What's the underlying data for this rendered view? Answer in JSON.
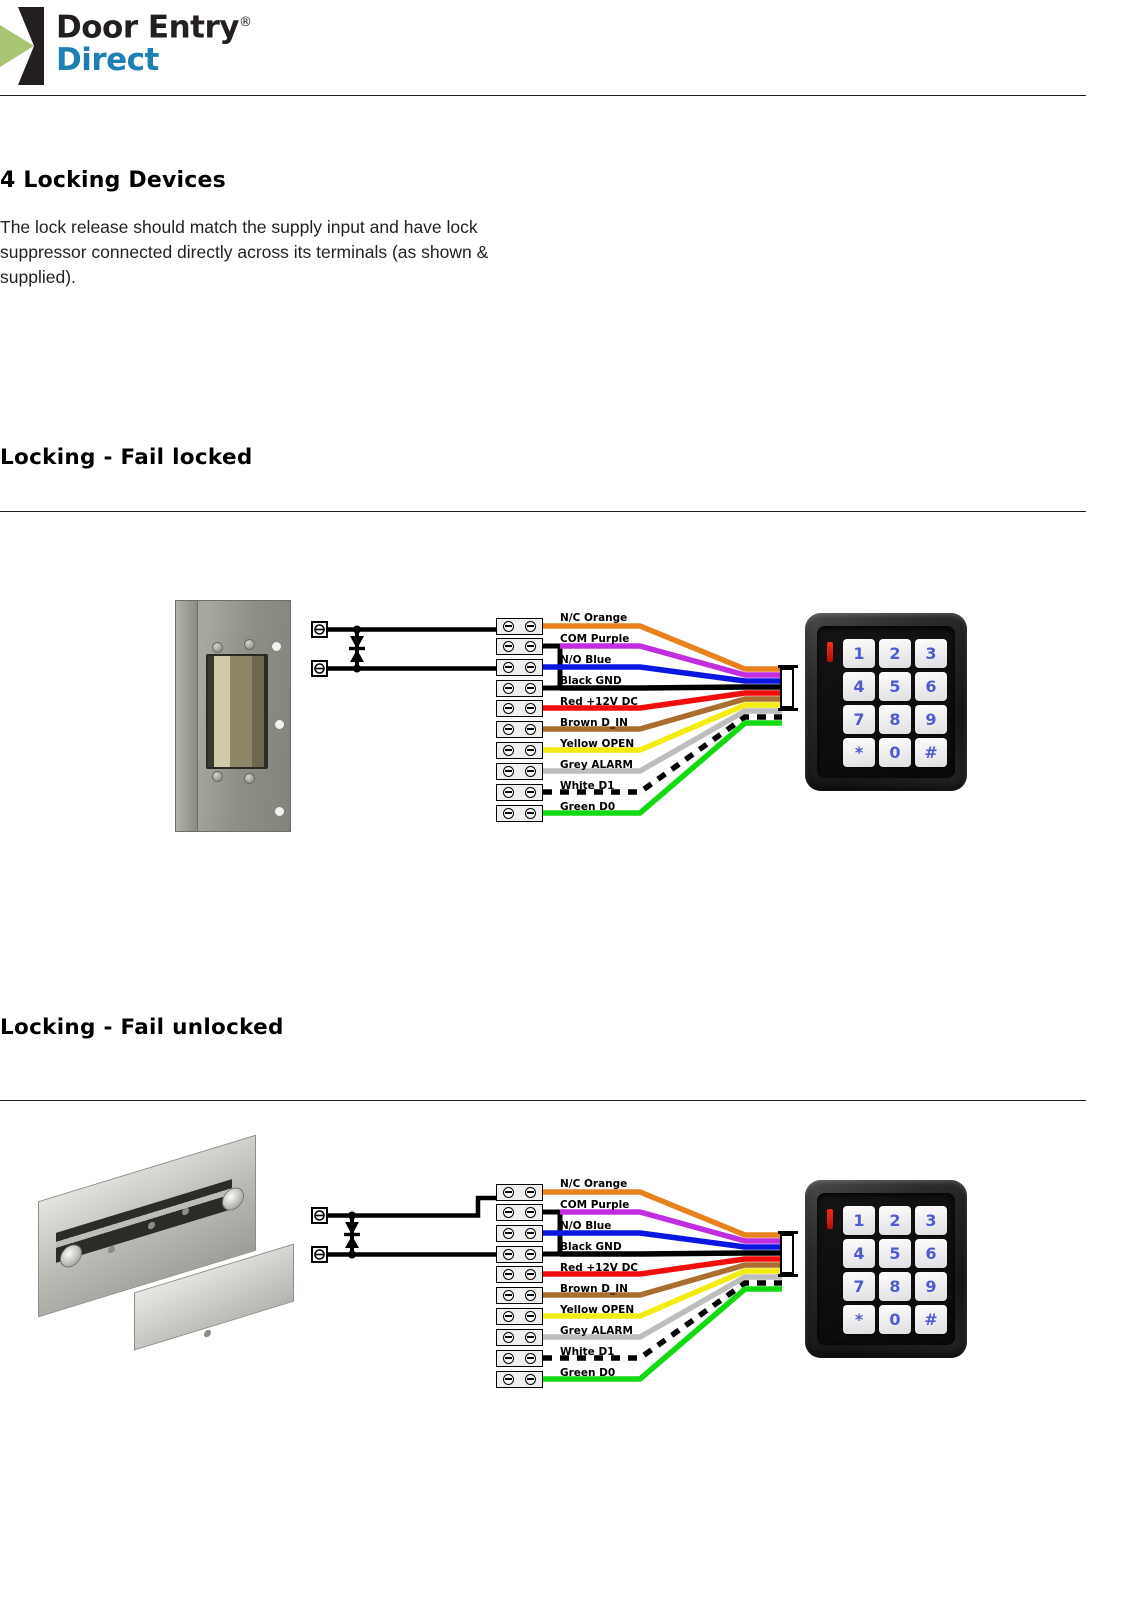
{
  "brand": {
    "line1": "Door Entry",
    "registered": "®",
    "line2": "Direct"
  },
  "section": {
    "number_title": "4 Locking Devices",
    "paragraph": "The lock release should match the supply input and have lock suppressor connected directly across its terminals (as shown & supplied)."
  },
  "subsections": [
    {
      "id": "fail-locked",
      "title": "Locking - Fail locked"
    },
    {
      "id": "fail-unlocked",
      "title": "Locking - Fail unlocked"
    }
  ],
  "wire_labels": [
    {
      "name": "N/C Orange",
      "color": "#e8821e"
    },
    {
      "name": "COM Purple",
      "color": "#c02ee0"
    },
    {
      "name": "N/O Blue",
      "color": "#0a17e0"
    },
    {
      "name": "Black GND",
      "color": "#000000"
    },
    {
      "name": "Red +12V DC",
      "color": "#f20d0d"
    },
    {
      "name": "Brown D_IN",
      "color": "#aa6f30"
    },
    {
      "name": "Yellow OPEN",
      "color": "#f2ec10"
    },
    {
      "name": "Grey ALARM",
      "color": "#bdbdbd"
    },
    {
      "name": "White D1",
      "color": "#000000"
    },
    {
      "name": "Green D0",
      "color": "#12d912"
    }
  ],
  "keypad": {
    "name": "access-control-keypad",
    "keys": [
      "1",
      "2",
      "3",
      "4",
      "5",
      "6",
      "7",
      "8",
      "9",
      "*",
      "0",
      "#"
    ],
    "led_color": "#ff2b1e",
    "key_text_color": "#4f5bd0"
  },
  "diagram_1": {
    "lock_device": "electric-strike-lock",
    "lock_caption": "",
    "suppressor": "diode-suppressor"
  },
  "diagram_2": {
    "lock_device": "magnetic-lock",
    "lock_caption": "",
    "suppressor": "diode-suppressor"
  }
}
